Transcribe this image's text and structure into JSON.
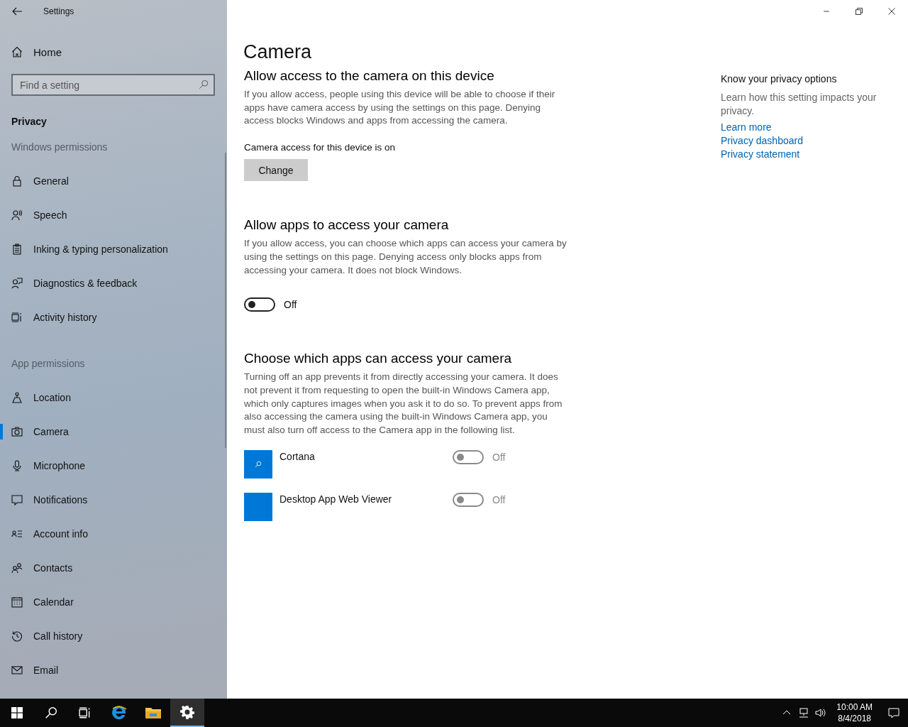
{
  "window": {
    "title": "Settings"
  },
  "sidebar": {
    "home": "Home",
    "search": {
      "placeholder": "Find a setting"
    },
    "section": "Privacy",
    "groups": [
      {
        "heading": "Windows permissions",
        "items": [
          {
            "label": "General",
            "selected": false
          },
          {
            "label": "Speech",
            "selected": false
          },
          {
            "label": "Inking & typing personalization",
            "selected": false
          },
          {
            "label": "Diagnostics & feedback",
            "selected": false
          },
          {
            "label": "Activity history",
            "selected": false
          }
        ]
      },
      {
        "heading": "App permissions",
        "items": [
          {
            "label": "Location",
            "selected": false
          },
          {
            "label": "Camera",
            "selected": true
          },
          {
            "label": "Microphone",
            "selected": false
          },
          {
            "label": "Notifications",
            "selected": false
          },
          {
            "label": "Account info",
            "selected": false
          },
          {
            "label": "Contacts",
            "selected": false
          },
          {
            "label": "Calendar",
            "selected": false
          },
          {
            "label": "Call history",
            "selected": false
          },
          {
            "label": "Email",
            "selected": false
          }
        ]
      }
    ]
  },
  "page": {
    "title": "Camera",
    "sections": [
      {
        "kind": "button",
        "heading": "Allow access to the camera on this device",
        "description": "If you allow access, people using this device will be able to choose if their apps have camera access by using the settings on this page. Denying access blocks Windows and apps from accessing the camera.",
        "status": "Camera access for this device is on",
        "button": "Change"
      },
      {
        "kind": "toggle",
        "heading": "Allow apps to access your camera",
        "description": "If you allow access, you can choose which apps can access your camera by using the settings on this page. Denying access only blocks apps from accessing your camera. It does not block Windows.",
        "toggle": {
          "on": false,
          "label": "Off"
        }
      },
      {
        "kind": "apps",
        "heading": "Choose which apps can access your camera",
        "description": "Turning off an app prevents it from directly accessing your camera. It does not prevent it from requesting to open the built-in Windows Camera app, which only captures images when you ask it to do so. To prevent apps from also accessing the camera using the built-in Windows Camera app, you must also turn off access to the Camera app in the following list.",
        "apps": [
          {
            "name": "Cortana",
            "on": false,
            "disabled": true,
            "label": "Off"
          },
          {
            "name": "Desktop App Web Viewer",
            "on": false,
            "disabled": true,
            "label": "Off"
          }
        ]
      }
    ]
  },
  "aside": {
    "heading": "Know your privacy options",
    "text": "Learn how this setting impacts your privacy.",
    "links": [
      "Learn more",
      "Privacy dashboard",
      "Privacy statement"
    ]
  },
  "taskbar": {
    "apps": [
      {
        "selected": false
      },
      {
        "selected": false
      },
      {
        "selected": false
      },
      {
        "selected": false
      },
      {
        "selected": true
      }
    ],
    "time": "10:00 AM",
    "date": "8/4/2018"
  }
}
